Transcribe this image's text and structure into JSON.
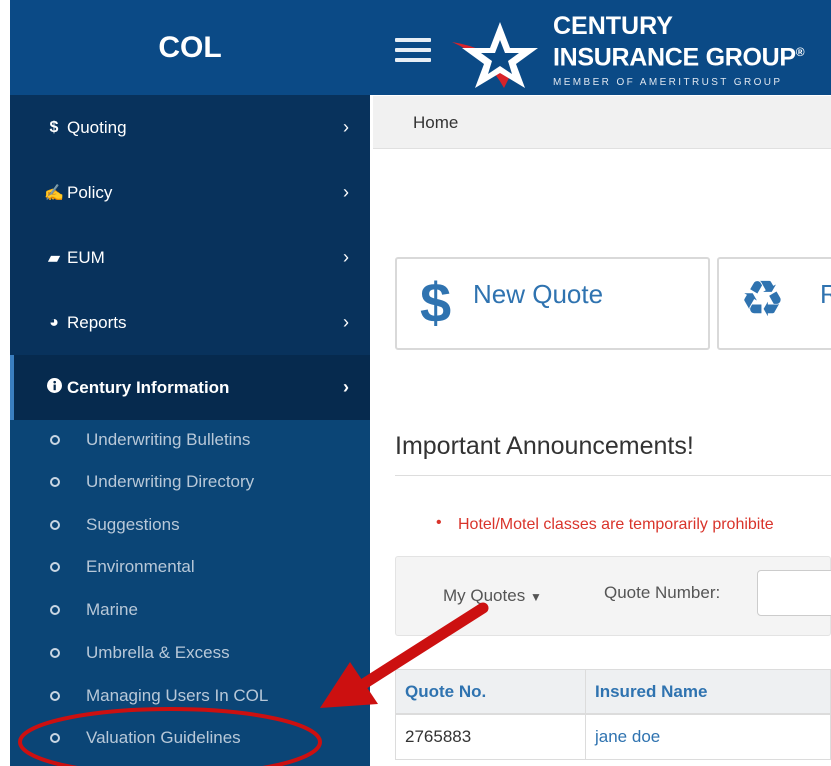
{
  "brand": {
    "title": "COL"
  },
  "logo": {
    "line1": "CENTURY",
    "line2": "INSURANCE GROUP",
    "registered": "®",
    "line3": "MEMBER OF AMERITRUST GROUP"
  },
  "sidebar": {
    "items": [
      {
        "label": "Quoting",
        "icon": "$"
      },
      {
        "label": "Policy",
        "icon": "stamp-icon"
      },
      {
        "label": "EUM",
        "icon": "book-icon"
      },
      {
        "label": "Reports",
        "icon": "pie-chart-icon"
      },
      {
        "label": "Century Information",
        "icon": "info-icon"
      }
    ],
    "submenu": [
      "Underwriting Bulletins",
      "Underwriting Directory",
      "Suggestions",
      "Environmental",
      "Marine",
      "Umbrella & Excess",
      "Managing Users In COL",
      "Valuation Guidelines"
    ]
  },
  "breadcrumb": {
    "home": "Home"
  },
  "actions": {
    "new_quote": "New Quote",
    "renew_partial": "R"
  },
  "announcements": {
    "title": "Important Announcements!",
    "items": [
      "Hotel/Motel classes are temporarily prohibite"
    ]
  },
  "filters": {
    "my_quotes": "My Quotes",
    "quote_number_label": "Quote Number:",
    "quote_number_value": ""
  },
  "table": {
    "headers": [
      "Quote No.",
      "Insured Name"
    ],
    "rows": [
      [
        "2765883",
        "jane doe"
      ]
    ]
  },
  "colors": {
    "header_bg": "#0b4a86",
    "sidebar_bg": "#08325c",
    "submenu_bg": "#0b4576",
    "link": "#2f73b0",
    "alert": "#d9342b",
    "annotation": "#cc1010"
  }
}
